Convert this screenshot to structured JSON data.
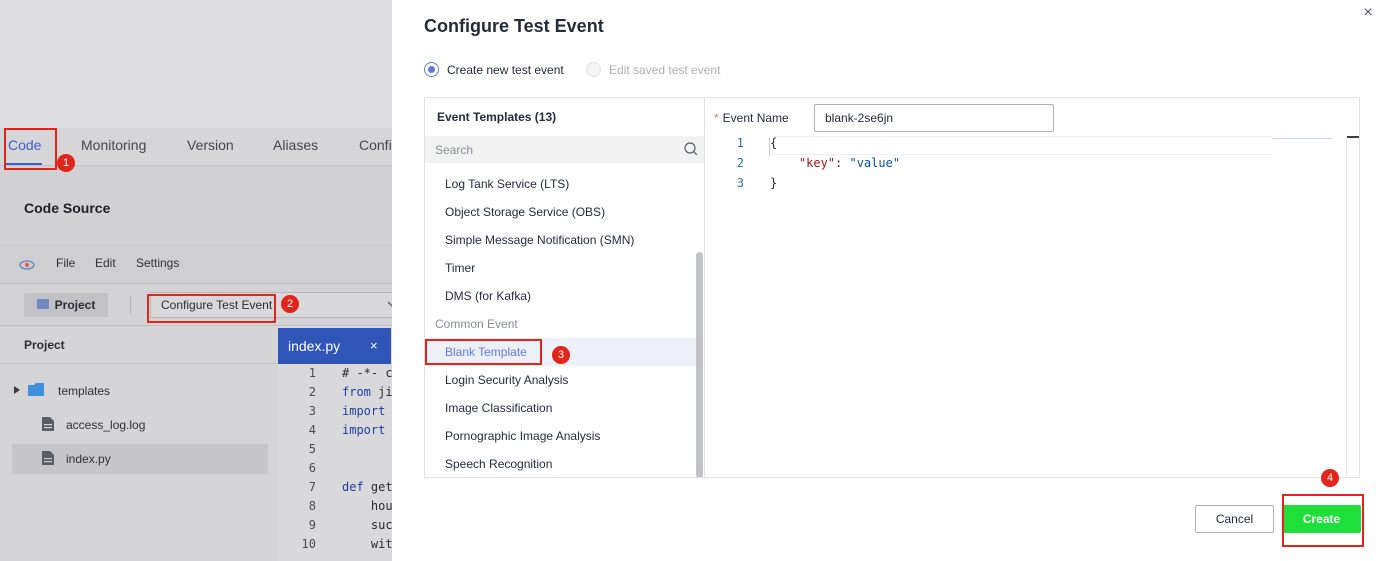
{
  "background": {
    "tabs": [
      "Code",
      "Monitoring",
      "Version",
      "Aliases",
      "Confi"
    ],
    "active_tab": "Code",
    "section_title": "Code Source",
    "menu": [
      "File",
      "Edit",
      "Settings"
    ],
    "project_button": "Project",
    "event_select_value": "Configure Test Event",
    "sidebar_title": "Project",
    "files": [
      {
        "name": "templates",
        "type": "folder"
      },
      {
        "name": "access_log.log",
        "type": "file"
      },
      {
        "name": "index.py",
        "type": "file"
      }
    ],
    "editor_tab": "index.py",
    "editor_tab_close": "×",
    "code_lines": [
      {
        "n": "1",
        "kw": "",
        "text": "# -*- c"
      },
      {
        "n": "2",
        "kw": "from",
        "text": " ji"
      },
      {
        "n": "3",
        "kw": "import",
        "text": ""
      },
      {
        "n": "4",
        "kw": "import",
        "text": ""
      },
      {
        "n": "5",
        "kw": "",
        "text": ""
      },
      {
        "n": "6",
        "kw": "",
        "text": ""
      },
      {
        "n": "7",
        "kw": "def",
        "text": " get"
      },
      {
        "n": "8",
        "kw": "",
        "text": "    hou"
      },
      {
        "n": "9",
        "kw": "",
        "text": "    suc"
      },
      {
        "n": "10",
        "kw": "",
        "text": "    wit"
      }
    ]
  },
  "annotations": [
    "1",
    "2",
    "3",
    "4"
  ],
  "dialog": {
    "title": "Configure Test Event",
    "close": "×",
    "radio_create": "Create new test event",
    "radio_edit": "Edit saved test event",
    "templates_title": "Event Templates (13)",
    "search_placeholder": "Search",
    "templates": [
      {
        "label": "Log Tank Service (LTS)",
        "kind": "item"
      },
      {
        "label": "Object Storage Service (OBS)",
        "kind": "item"
      },
      {
        "label": "Simple Message Notification (SMN)",
        "kind": "item"
      },
      {
        "label": "Timer",
        "kind": "item"
      },
      {
        "label": "DMS (for Kafka)",
        "kind": "item"
      },
      {
        "label": "Common Event",
        "kind": "group"
      },
      {
        "label": "Blank Template",
        "kind": "selected"
      },
      {
        "label": "Login Security Analysis",
        "kind": "item"
      },
      {
        "label": "Image Classification",
        "kind": "item"
      },
      {
        "label": "Pornographic Image Analysis",
        "kind": "item"
      },
      {
        "label": "Speech Recognition",
        "kind": "item"
      }
    ],
    "event_name_label": "Event Name",
    "event_name_required": "*",
    "event_name_value": "blank-2se6jn",
    "editor_lines": [
      {
        "n": "1",
        "text": "{"
      },
      {
        "n": "2",
        "key": "\"key\"",
        "sep": ": ",
        "val": "\"value\""
      },
      {
        "n": "3",
        "text": "}"
      }
    ],
    "cancel_label": "Cancel",
    "create_label": "Create"
  },
  "colors": {
    "accent": "#5e7ce0",
    "create_button": "#1fe03a",
    "annotation_red": "#e1251b"
  }
}
